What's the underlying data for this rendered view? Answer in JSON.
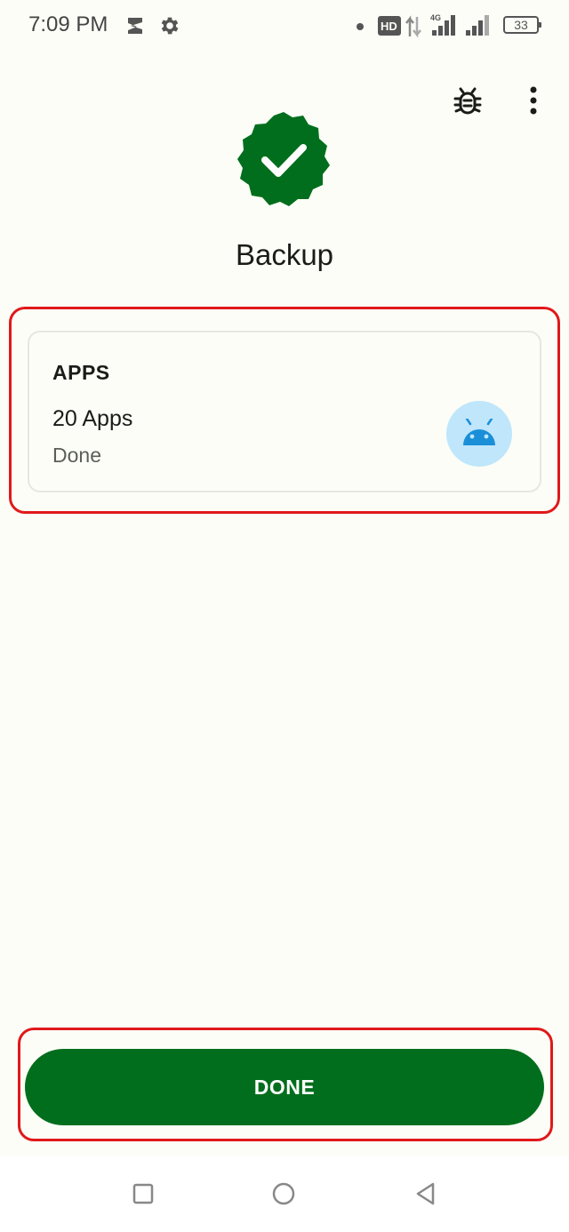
{
  "status_bar": {
    "time": "7:09 PM",
    "battery": "33",
    "icons": [
      "shield-icon",
      "gear-icon",
      "hd-icon",
      "data-arrows-icon",
      "signal-4g-icon",
      "signal-icon",
      "battery-icon"
    ]
  },
  "toolbar": {
    "icons": [
      "bug-icon",
      "more-vert-icon"
    ]
  },
  "header": {
    "badge_icon": "check-badge-icon",
    "title": "Backup"
  },
  "card": {
    "heading": "APPS",
    "count": "20 Apps",
    "status": "Done",
    "icon": "android-icon"
  },
  "actions": {
    "done_label": "DONE"
  },
  "nav_bar": {
    "icons": [
      "recents-square-icon",
      "home-circle-icon",
      "back-triangle-icon"
    ]
  },
  "colors": {
    "background": "#fcfdf7",
    "primary": "#006e1c",
    "avatar_bg": "#bfe6fb",
    "android": "#1a8fd8",
    "highlight": "#e0191a"
  }
}
